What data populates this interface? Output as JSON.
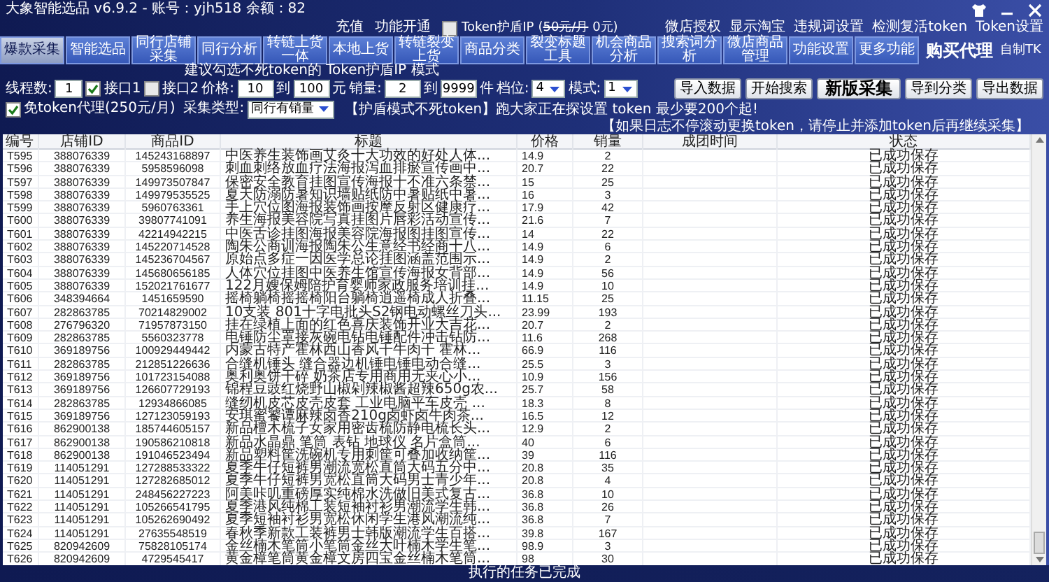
{
  "window": {
    "title": "大象智能选品 v6.9.2 - 账号：yjh518 余额：82"
  },
  "top_links": [
    {
      "label": "充值"
    },
    {
      "label": "功能开通"
    }
  ],
  "token_shield": {
    "label": "Token护盾IP",
    "checked": false,
    "price_open": "(",
    "price_old": "50元/月",
    "price_new": " 0元)"
  },
  "account_links": [
    {
      "label": "微店授权"
    },
    {
      "label": "显示淘宝"
    },
    {
      "label": "违规词设置"
    },
    {
      "label": "检测复活token"
    },
    {
      "label": "Token设置"
    }
  ],
  "tabs": [
    {
      "label": "爆款采集",
      "selected": true
    },
    {
      "label": "智能选品",
      "selected": false
    },
    {
      "label": "同行店铺采集",
      "selected": false
    },
    {
      "label": "同行分析",
      "selected": false
    },
    {
      "label": "转链上货一体",
      "selected": false
    },
    {
      "label": "本地上货",
      "selected": false
    },
    {
      "label": "转链裂变上货",
      "selected": false
    },
    {
      "label": "商品分类",
      "selected": false
    },
    {
      "label": "裂变标题工具",
      "selected": false
    },
    {
      "label": "机会商品分析",
      "selected": false
    },
    {
      "label": "搜索词分析",
      "selected": false
    },
    {
      "label": "微店商品管理",
      "selected": false
    },
    {
      "label": "功能设置",
      "selected": false
    },
    {
      "label": "更多功能",
      "selected": false
    }
  ],
  "extra_links": [
    {
      "label": "购买代理",
      "kind": "large"
    },
    {
      "label": "自制TK",
      "kind": "small"
    }
  ],
  "controls": {
    "hint": "建议勾选不死token的  Token护盾IP 模式",
    "threads": {
      "label": "线程数:",
      "value": "1"
    },
    "api1": {
      "label": "接口1",
      "checked": true
    },
    "api2": {
      "label": "接口2",
      "checked": false
    },
    "price": {
      "label": "价格:",
      "min": "10",
      "to": "到",
      "max": "100",
      "unit": "元"
    },
    "sales": {
      "label": "销量:",
      "min": "2",
      "to": "到",
      "max": "9999",
      "unit": "件"
    },
    "tier": {
      "label": "档位:",
      "value": "4"
    },
    "mode": {
      "label": "模式:",
      "value": "1"
    },
    "free_proxy": {
      "label": "免token代理(250元/月)",
      "checked": true
    },
    "collect_type": {
      "label": "采集类型:",
      "value": "同行有销量"
    },
    "notice_1": "【护盾模式不死token】跑大家正在探设置  token 最少要200个起!",
    "notice_2": "【如果日志不停滚动更换token，请停止并添加token后再继续采集】"
  },
  "buttons": [
    {
      "label": "导入数据",
      "kind": "normal"
    },
    {
      "label": "开始搜索",
      "kind": "normal"
    },
    {
      "label": "新版采集",
      "kind": "primary"
    },
    {
      "label": "导到分类",
      "kind": "normal"
    },
    {
      "label": "导出数据",
      "kind": "normal"
    }
  ],
  "table": {
    "columns": [
      "编号",
      "店铺ID",
      "商品ID",
      "标题",
      "价格",
      "销量",
      "成团时间",
      "状态"
    ],
    "rows": [
      {
        "no": "T595",
        "shop_id": "388076339",
        "item_id": "145243168897",
        "title": "中医养生装饰画艾灸十大功效的好处人体...",
        "price": "14.9",
        "sales": "2",
        "status": "已成功保存"
      },
      {
        "no": "T596",
        "shop_id": "388076339",
        "item_id": "5958596098",
        "title": "刺血刺络放血疗法海报泻血排瘀宣传画中...",
        "price": "20.7",
        "sales": "22",
        "status": "已成功保存"
      },
      {
        "no": "T597",
        "shop_id": "388076339",
        "item_id": "149973507847",
        "title": "保密安全教育挂图宣传海报十不准六条禁...",
        "price": "15",
        "sales": "25",
        "status": "已成功保存"
      },
      {
        "no": "T598",
        "shop_id": "388076339",
        "item_id": "149979535525",
        "title": "夏天防溺防暑知识墙贴纸防中暑贴纸中暑...",
        "price": "16",
        "sales": "3",
        "status": "已成功保存"
      },
      {
        "no": "T599",
        "shop_id": "388076339",
        "item_id": "5960763361",
        "title": "手上穴位图海报装饰画按摩反射区健康疗...",
        "price": "17.9",
        "sales": "42",
        "status": "已成功保存"
      },
      {
        "no": "T600",
        "shop_id": "388076339",
        "item_id": "39807741091",
        "title": "养生海报美容院写真挂图片唇彩活动宣传...",
        "price": "21.6",
        "sales": "7",
        "status": "已成功保存"
      },
      {
        "no": "T601",
        "shop_id": "388076339",
        "item_id": "42214942215",
        "title": "中医舌诊挂图海报美容院海报图挂图宣传...",
        "price": "14",
        "sales": "22",
        "status": "已成功保存"
      },
      {
        "no": "T602",
        "shop_id": "388076339",
        "item_id": "145220714528",
        "title": "陶朱公商训海报陶朱公生意经书经商十八...",
        "price": "14.9",
        "sales": "6",
        "status": "已成功保存"
      },
      {
        "no": "T603",
        "shop_id": "388076339",
        "item_id": "145236704567",
        "title": "原始点多症一因医学总论挂图涵盖范围示...",
        "price": "14.9",
        "sales": "2",
        "status": "已成功保存"
      },
      {
        "no": "T604",
        "shop_id": "388076339",
        "item_id": "145680656185",
        "title": "人体穴位挂图中医养生馆宣传海报女背部...",
        "price": "14.9",
        "sales": "56",
        "status": "已成功保存"
      },
      {
        "no": "T605",
        "shop_id": "388076339",
        "item_id": "152021761677",
        "title": "122月嫂保姆陪护育婴师家政服务培训挂...",
        "price": "14.9",
        "sales": "10",
        "status": "已成功保存"
      },
      {
        "no": "T606",
        "shop_id": "348394664",
        "item_id": "1451659590",
        "title": "摇椅躺椅摇摇椅阳台躺椅逍遥椅成人折叠...",
        "price": "11.15",
        "sales": "25",
        "status": "已成功保存"
      },
      {
        "no": "T607",
        "shop_id": "282863785",
        "item_id": "70214829002",
        "title": "10支装 801十字电批头S2钢电动螺丝刀头...",
        "price": "23.99",
        "sales": "193",
        "status": "已成功保存"
      },
      {
        "no": "T608",
        "shop_id": "276796320",
        "item_id": "71957873150",
        "title": "挂在绿植上面的红色喜庆装饰开业大吉花...",
        "price": "20.7",
        "sales": "2",
        "status": "已成功保存"
      },
      {
        "no": "T609",
        "shop_id": "282863785",
        "item_id": "5560323778",
        "title": "电锤防尘罩接灰碗电钻电锤配件冲击钻防...",
        "price": "11.6",
        "sales": "268",
        "status": "已成功保存"
      },
      {
        "no": "T610",
        "shop_id": "369189756",
        "item_id": "100929449442",
        "title": "内蒙古特产霍林西山香风干牛肉干 霍林...",
        "price": "66.9",
        "sales": "116",
        "status": "已成功保存"
      },
      {
        "no": "T611",
        "shop_id": "282863785",
        "item_id": "212851226636",
        "title": "合缝机锤头 缝合器边机锤电锤电动合缝...",
        "price": "25.5",
        "sales": "3",
        "status": "已成功保存"
      },
      {
        "no": "T612",
        "shop_id": "369189756",
        "item_id": "101723154088",
        "title": "奥利奥饼干碎 奶茶店专用商用无夹心小...",
        "price": "10.9",
        "sales": "156",
        "status": "已成功保存"
      },
      {
        "no": "T613",
        "shop_id": "369189756",
        "item_id": "126607729193",
        "title": "锦程豆豉红烧野山椒剁辣椒酱超辣650g农...",
        "price": "25.7",
        "sales": "58",
        "status": "已成功保存"
      },
      {
        "no": "T614",
        "shop_id": "282863785",
        "item_id": "12934866085",
        "title": "缝纫机皮芯皮壳皮套 工业电脑平车皮壳 ...",
        "price": "18.3",
        "sales": "8",
        "status": "已成功保存"
      },
      {
        "no": "T615",
        "shop_id": "369189756",
        "item_id": "127123059193",
        "title": "安琪蜜饕谭麻辣卤香210g卤虾卤牛肉茶...",
        "price": "16.5",
        "sales": "12",
        "status": "已成功保存"
      },
      {
        "no": "T616",
        "shop_id": "862900138",
        "item_id": "185744605157",
        "title": "新品檀木梳子女家用密齿梳防静电梳长头...",
        "price": "12.9",
        "sales": "2",
        "status": "已成功保存"
      },
      {
        "no": "T617",
        "shop_id": "862900138",
        "item_id": "190586210818",
        "title": "新品水晶鼎 笔筒 表钻 地球仪 名片盒筒...",
        "price": "40",
        "sales": "6",
        "status": "已成功保存"
      },
      {
        "no": "T618",
        "shop_id": "862900138",
        "item_id": "191046523494",
        "title": "新品塑料筐洗碗机专用刺筐可叠加收纳筐...",
        "price": "39",
        "sales": "116",
        "status": "已成功保存"
      },
      {
        "no": "T619",
        "shop_id": "114051291",
        "item_id": "127288533322",
        "title": "夏季牛仔短裤男潮流宽松直筒大码五分中...",
        "price": "20.8",
        "sales": "35",
        "status": "已成功保存"
      },
      {
        "no": "T620",
        "shop_id": "114051291",
        "item_id": "127282685012",
        "title": "夏季牛仔短裤男宽松直筒大码男士青少年...",
        "price": "20.8",
        "sales": "4",
        "status": "已成功保存"
      },
      {
        "no": "T621",
        "shop_id": "114051291",
        "item_id": "248456227223",
        "title": "阿美咔叽重磅厚实纯棉水洗做旧美式复古...",
        "price": "36.8",
        "sales": "10",
        "status": "已成功保存"
      },
      {
        "no": "T622",
        "shop_id": "114051291",
        "item_id": "105266541795",
        "title": "夏季港风纯棉工装短袖衬衫男潮流学生韩...",
        "price": "36.8",
        "sales": "26",
        "status": "已成功保存"
      },
      {
        "no": "T623",
        "shop_id": "114051291",
        "item_id": "105262690492",
        "title": "夏季短袖衬衫男宽松休闲学生港风潮流纯...",
        "price": "36.8",
        "sales": "7",
        "status": "已成功保存"
      },
      {
        "no": "T624",
        "shop_id": "114051291",
        "item_id": "27635548519",
        "title": "春秋季新款工装裤男士韩版潮流学生百搭...",
        "price": "39.8",
        "sales": "167",
        "status": "已成功保存"
      },
      {
        "no": "T625",
        "shop_id": "820942609",
        "item_id": "75828105174",
        "title": "金丝楠木笔筒小笔筒金丝大叶楠木学生笔...",
        "price": "98.9",
        "sales": "3",
        "status": "已成功保存"
      },
      {
        "no": "T626",
        "shop_id": "820942609",
        "item_id": "4729545417",
        "title": "黄金樟笔筒黄金樟文房四宝金丝楠木笔筒...",
        "price": "98",
        "sales": "30",
        "status": "已成功保存"
      }
    ]
  },
  "status_bar": "执行的任务已完成"
}
